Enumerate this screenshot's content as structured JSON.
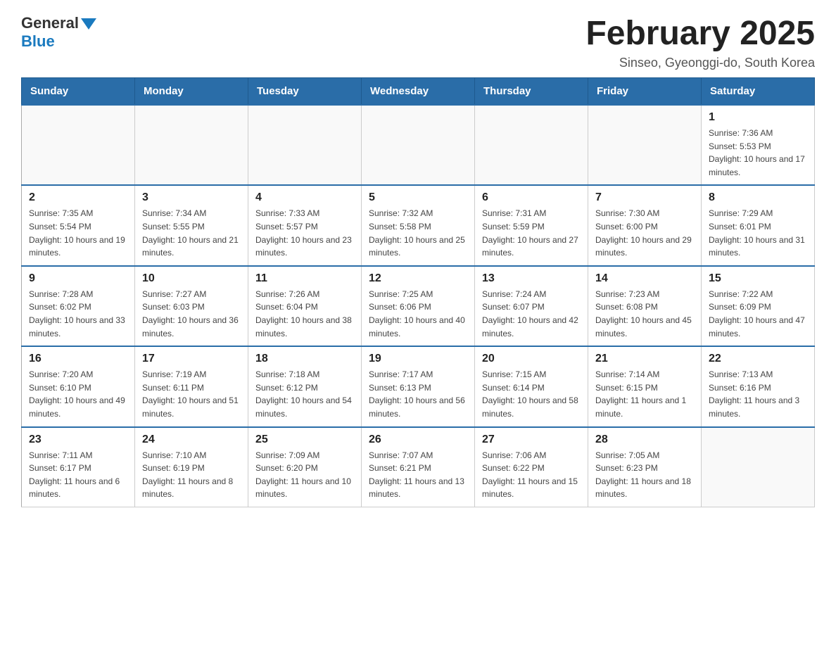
{
  "logo": {
    "text_general": "General",
    "text_blue": "Blue"
  },
  "title": "February 2025",
  "subtitle": "Sinseo, Gyeonggi-do, South Korea",
  "headers": [
    "Sunday",
    "Monday",
    "Tuesday",
    "Wednesday",
    "Thursday",
    "Friday",
    "Saturday"
  ],
  "weeks": [
    [
      {
        "day": "",
        "sunrise": "",
        "sunset": "",
        "daylight": ""
      },
      {
        "day": "",
        "sunrise": "",
        "sunset": "",
        "daylight": ""
      },
      {
        "day": "",
        "sunrise": "",
        "sunset": "",
        "daylight": ""
      },
      {
        "day": "",
        "sunrise": "",
        "sunset": "",
        "daylight": ""
      },
      {
        "day": "",
        "sunrise": "",
        "sunset": "",
        "daylight": ""
      },
      {
        "day": "",
        "sunrise": "",
        "sunset": "",
        "daylight": ""
      },
      {
        "day": "1",
        "sunrise": "Sunrise: 7:36 AM",
        "sunset": "Sunset: 5:53 PM",
        "daylight": "Daylight: 10 hours and 17 minutes."
      }
    ],
    [
      {
        "day": "2",
        "sunrise": "Sunrise: 7:35 AM",
        "sunset": "Sunset: 5:54 PM",
        "daylight": "Daylight: 10 hours and 19 minutes."
      },
      {
        "day": "3",
        "sunrise": "Sunrise: 7:34 AM",
        "sunset": "Sunset: 5:55 PM",
        "daylight": "Daylight: 10 hours and 21 minutes."
      },
      {
        "day": "4",
        "sunrise": "Sunrise: 7:33 AM",
        "sunset": "Sunset: 5:57 PM",
        "daylight": "Daylight: 10 hours and 23 minutes."
      },
      {
        "day": "5",
        "sunrise": "Sunrise: 7:32 AM",
        "sunset": "Sunset: 5:58 PM",
        "daylight": "Daylight: 10 hours and 25 minutes."
      },
      {
        "day": "6",
        "sunrise": "Sunrise: 7:31 AM",
        "sunset": "Sunset: 5:59 PM",
        "daylight": "Daylight: 10 hours and 27 minutes."
      },
      {
        "day": "7",
        "sunrise": "Sunrise: 7:30 AM",
        "sunset": "Sunset: 6:00 PM",
        "daylight": "Daylight: 10 hours and 29 minutes."
      },
      {
        "day": "8",
        "sunrise": "Sunrise: 7:29 AM",
        "sunset": "Sunset: 6:01 PM",
        "daylight": "Daylight: 10 hours and 31 minutes."
      }
    ],
    [
      {
        "day": "9",
        "sunrise": "Sunrise: 7:28 AM",
        "sunset": "Sunset: 6:02 PM",
        "daylight": "Daylight: 10 hours and 33 minutes."
      },
      {
        "day": "10",
        "sunrise": "Sunrise: 7:27 AM",
        "sunset": "Sunset: 6:03 PM",
        "daylight": "Daylight: 10 hours and 36 minutes."
      },
      {
        "day": "11",
        "sunrise": "Sunrise: 7:26 AM",
        "sunset": "Sunset: 6:04 PM",
        "daylight": "Daylight: 10 hours and 38 minutes."
      },
      {
        "day": "12",
        "sunrise": "Sunrise: 7:25 AM",
        "sunset": "Sunset: 6:06 PM",
        "daylight": "Daylight: 10 hours and 40 minutes."
      },
      {
        "day": "13",
        "sunrise": "Sunrise: 7:24 AM",
        "sunset": "Sunset: 6:07 PM",
        "daylight": "Daylight: 10 hours and 42 minutes."
      },
      {
        "day": "14",
        "sunrise": "Sunrise: 7:23 AM",
        "sunset": "Sunset: 6:08 PM",
        "daylight": "Daylight: 10 hours and 45 minutes."
      },
      {
        "day": "15",
        "sunrise": "Sunrise: 7:22 AM",
        "sunset": "Sunset: 6:09 PM",
        "daylight": "Daylight: 10 hours and 47 minutes."
      }
    ],
    [
      {
        "day": "16",
        "sunrise": "Sunrise: 7:20 AM",
        "sunset": "Sunset: 6:10 PM",
        "daylight": "Daylight: 10 hours and 49 minutes."
      },
      {
        "day": "17",
        "sunrise": "Sunrise: 7:19 AM",
        "sunset": "Sunset: 6:11 PM",
        "daylight": "Daylight: 10 hours and 51 minutes."
      },
      {
        "day": "18",
        "sunrise": "Sunrise: 7:18 AM",
        "sunset": "Sunset: 6:12 PM",
        "daylight": "Daylight: 10 hours and 54 minutes."
      },
      {
        "day": "19",
        "sunrise": "Sunrise: 7:17 AM",
        "sunset": "Sunset: 6:13 PM",
        "daylight": "Daylight: 10 hours and 56 minutes."
      },
      {
        "day": "20",
        "sunrise": "Sunrise: 7:15 AM",
        "sunset": "Sunset: 6:14 PM",
        "daylight": "Daylight: 10 hours and 58 minutes."
      },
      {
        "day": "21",
        "sunrise": "Sunrise: 7:14 AM",
        "sunset": "Sunset: 6:15 PM",
        "daylight": "Daylight: 11 hours and 1 minute."
      },
      {
        "day": "22",
        "sunrise": "Sunrise: 7:13 AM",
        "sunset": "Sunset: 6:16 PM",
        "daylight": "Daylight: 11 hours and 3 minutes."
      }
    ],
    [
      {
        "day": "23",
        "sunrise": "Sunrise: 7:11 AM",
        "sunset": "Sunset: 6:17 PM",
        "daylight": "Daylight: 11 hours and 6 minutes."
      },
      {
        "day": "24",
        "sunrise": "Sunrise: 7:10 AM",
        "sunset": "Sunset: 6:19 PM",
        "daylight": "Daylight: 11 hours and 8 minutes."
      },
      {
        "day": "25",
        "sunrise": "Sunrise: 7:09 AM",
        "sunset": "Sunset: 6:20 PM",
        "daylight": "Daylight: 11 hours and 10 minutes."
      },
      {
        "day": "26",
        "sunrise": "Sunrise: 7:07 AM",
        "sunset": "Sunset: 6:21 PM",
        "daylight": "Daylight: 11 hours and 13 minutes."
      },
      {
        "day": "27",
        "sunrise": "Sunrise: 7:06 AM",
        "sunset": "Sunset: 6:22 PM",
        "daylight": "Daylight: 11 hours and 15 minutes."
      },
      {
        "day": "28",
        "sunrise": "Sunrise: 7:05 AM",
        "sunset": "Sunset: 6:23 PM",
        "daylight": "Daylight: 11 hours and 18 minutes."
      },
      {
        "day": "",
        "sunrise": "",
        "sunset": "",
        "daylight": ""
      }
    ]
  ]
}
